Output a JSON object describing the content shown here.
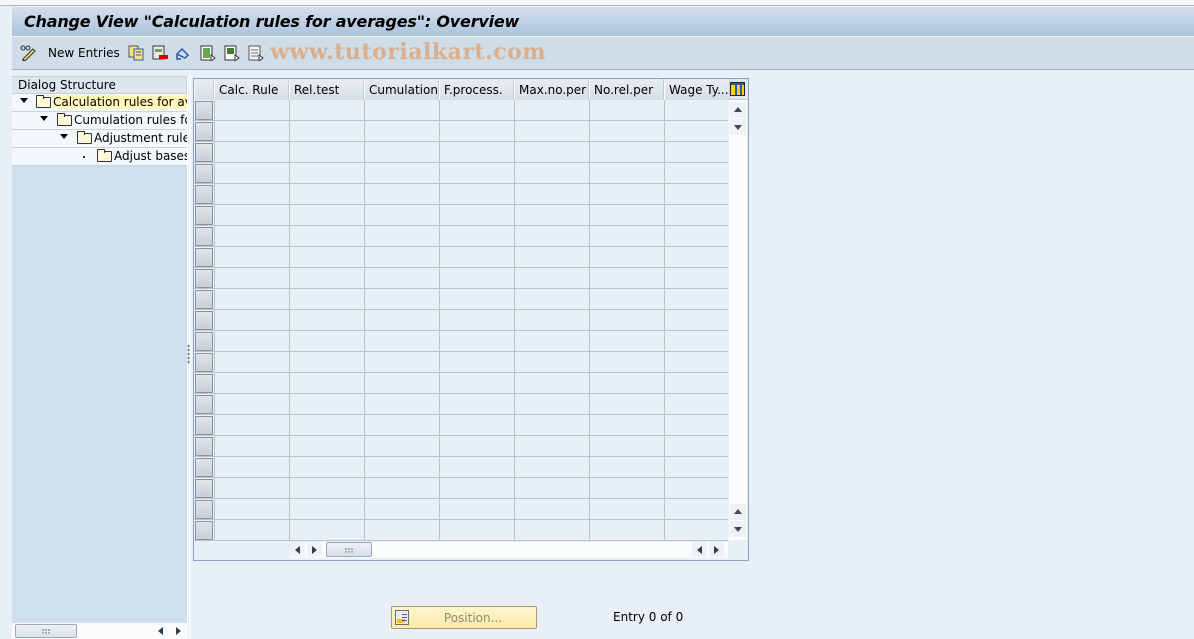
{
  "window": {
    "title": "Change View \"Calculation rules for averages\": Overview"
  },
  "toolbar": {
    "items": [
      {
        "icon": "display-change-icon",
        "label": ""
      },
      {
        "icon": "new-entries-label",
        "label": "New Entries"
      },
      {
        "icon": "copy-as-icon",
        "label": ""
      },
      {
        "icon": "delete-icon",
        "label": ""
      },
      {
        "icon": "undo-change-icon",
        "label": ""
      },
      {
        "icon": "select-all-icon",
        "label": ""
      },
      {
        "icon": "select-block-icon",
        "label": ""
      },
      {
        "icon": "deselect-all-icon",
        "label": ""
      }
    ],
    "new_entries_label": "New Entries"
  },
  "watermark": "www.tutorialkart.com",
  "dialog_structure": {
    "header": "Dialog Structure",
    "nodes": [
      {
        "label": "Calculation rules for aver",
        "level": 0,
        "expanded": true,
        "selected": true
      },
      {
        "label": "Cumulation rules for",
        "level": 1,
        "expanded": true,
        "selected": false
      },
      {
        "label": "Adjustment rules",
        "level": 2,
        "expanded": true,
        "selected": false
      },
      {
        "label": "Adjust bases",
        "level": 3,
        "expanded": false,
        "selected": false
      }
    ]
  },
  "table": {
    "columns": [
      "Calc. Rule",
      "Rel.test",
      "Cumulation",
      "F.process.",
      "Max.no.per",
      "No.rel.per",
      "Wage Ty..."
    ],
    "visible_rows": 21,
    "rows": []
  },
  "footer": {
    "position_button": "Position...",
    "entry_text": "Entry 0 of 0"
  },
  "colors": {
    "title_gradient_top": "#d2e0ec",
    "title_gradient_bottom": "#adc3db",
    "toolbar_bg": "#cfdde8",
    "page_bg": "#e8eff6",
    "selected_node_bg": "#fef7b8",
    "position_button_bg": "#fbe9a6"
  }
}
